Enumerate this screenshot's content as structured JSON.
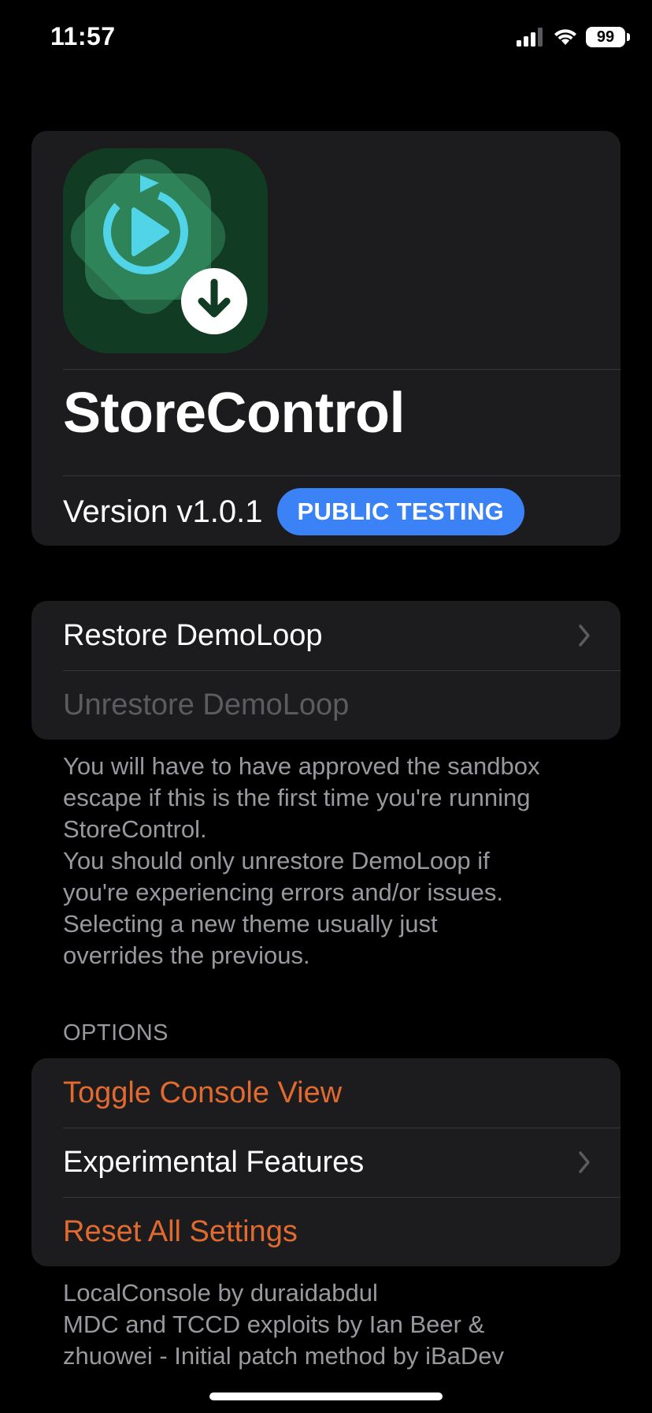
{
  "status_bar": {
    "time": "11:57",
    "battery": "99",
    "icons": [
      "cellular-signal-icon",
      "wifi-icon",
      "battery-icon"
    ]
  },
  "app": {
    "name": "StoreControl",
    "version": "Version v1.0.1",
    "badge": "PUBLIC TESTING",
    "icon": "app-icon-replay-download"
  },
  "restore_section": {
    "restore_label": "Restore DemoLoop",
    "unrestore_label": "Unrestore DemoLoop",
    "footer_lines": [
      "You will have to have approved the sandbox",
      "escape if this is the first time you're running",
      "StoreControl.",
      "You should only unrestore DemoLoop if",
      "you're experiencing errors and/or issues.",
      "Selecting a new theme usually just",
      "overrides the previous."
    ]
  },
  "options_section": {
    "header": "OPTIONS",
    "toggle_console": "Toggle Console View",
    "experimental": "Experimental Features",
    "reset": "Reset All Settings",
    "footer_lines": [
      "LocalConsole by duraidabdul",
      "MDC and TCCD exploits by Ian Beer &",
      "zhuowei - Initial patch method by iBaDev"
    ]
  },
  "colors": {
    "background": "#000000",
    "card": "#1c1c1e",
    "accent_blue": "#3a82f6",
    "destructive_orange": "#e06a2f",
    "secondary_text": "#98989e",
    "disabled_text": "#5c5c60"
  }
}
